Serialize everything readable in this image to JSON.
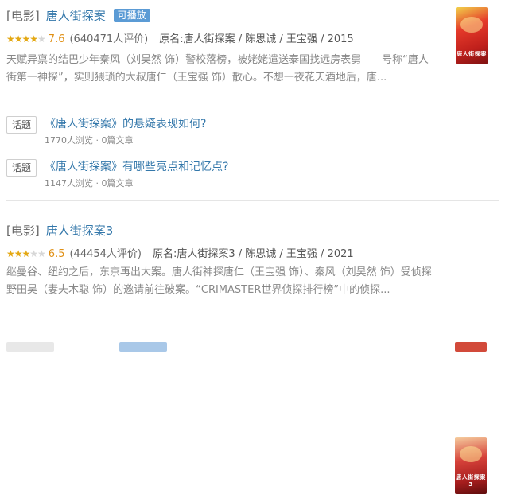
{
  "results": [
    {
      "category": "[电影]",
      "title": "唐人街探案",
      "badge": "可播放",
      "stars": "★★★★",
      "stars_off": "★",
      "score": "7.6",
      "rating_count": "(640471人评价)",
      "meta": "原名:唐人街探案 / 陈思诚 / 王宝强 / 2015",
      "description": "天赋异禀的结巴少年秦风（刘昊然 饰）警校落榜，被姥姥遣送泰国找远房表舅——号称“唐人街第一神探”，实则猥琐的大叔唐仁（王宝强 饰）散心。不想一夜花天酒地后，唐...",
      "poster_text": "唐人街探案",
      "topics": [
        {
          "tag": "话题",
          "title": "《唐人街探案》的悬疑表现如何?",
          "meta": "1770人浏览 · 0篇文章"
        },
        {
          "tag": "话题",
          "title": "《唐人街探案》有哪些亮点和记忆点?",
          "meta": "1147人浏览 · 0篇文章"
        }
      ]
    },
    {
      "category": "[电影]",
      "title": "唐人街探案3",
      "stars": "★★★",
      "stars_off": "★★",
      "score": "6.5",
      "rating_count": "(44454人评价)",
      "meta": "原名:唐人街探案3 / 陈思诚 / 王宝强 / 2021",
      "description": "继曼谷、纽约之后，东京再出大案。唐人街神探唐仁（王宝强 饰）、秦风（刘昊然 饰）受侦探野田昊（妻夫木聪 饰）的邀请前往破案。“CRIMASTER世界侦探排行榜”中的侦探...",
      "poster_text": "唐人街探案3"
    }
  ],
  "colors": {
    "link": "#3377aa",
    "star": "#e4a813",
    "badge": "#5b9bd5",
    "score": "#e09015"
  }
}
